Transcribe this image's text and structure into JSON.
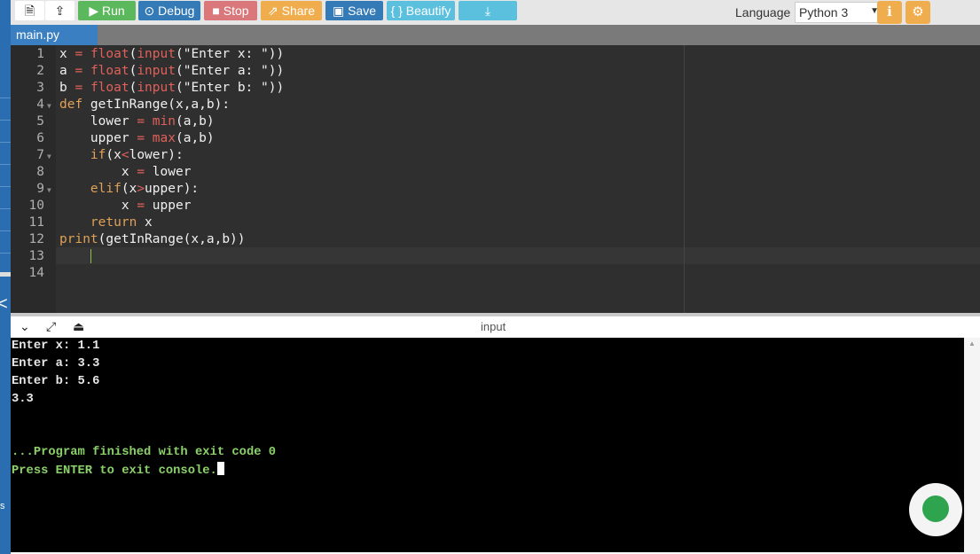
{
  "toolbar": {
    "run": "Run",
    "debug": "Debug",
    "stop": "Stop",
    "share": "Share",
    "save": "Save",
    "beautify": "{ } Beautify",
    "language_label": "Language",
    "language_value": "Python 3"
  },
  "tabs": [
    {
      "label": "main.py"
    }
  ],
  "code": [
    [
      [
        "x ",
        ""
      ],
      [
        "= ",
        "op"
      ],
      [
        "float",
        "fn"
      ],
      [
        "(",
        ""
      ],
      [
        "input",
        "fn"
      ],
      [
        "(\"Enter x: \"))",
        ""
      ]
    ],
    [
      [
        "a ",
        ""
      ],
      [
        "= ",
        "op"
      ],
      [
        "float",
        "fn"
      ],
      [
        "(",
        ""
      ],
      [
        "input",
        "fn"
      ],
      [
        "(\"Enter a: \"))",
        ""
      ]
    ],
    [
      [
        "b ",
        ""
      ],
      [
        "= ",
        "op"
      ],
      [
        "float",
        "fn"
      ],
      [
        "(",
        ""
      ],
      [
        "input",
        "fn"
      ],
      [
        "(\"Enter b: \"))",
        ""
      ]
    ],
    [
      [
        "def",
        "kw"
      ],
      [
        " getInRange(x,a,b):",
        ""
      ]
    ],
    [
      [
        "    lower ",
        ""
      ],
      [
        "= ",
        "op"
      ],
      [
        "min",
        "fn"
      ],
      [
        "(a,b)",
        ""
      ]
    ],
    [
      [
        "    upper ",
        ""
      ],
      [
        "= ",
        "op"
      ],
      [
        "max",
        "fn"
      ],
      [
        "(a,b)",
        ""
      ]
    ],
    [
      [
        "    ",
        ""
      ],
      [
        "if",
        "kw"
      ],
      [
        "(x",
        ""
      ],
      [
        "<",
        "op"
      ],
      [
        "lower):",
        ""
      ]
    ],
    [
      [
        "        x ",
        ""
      ],
      [
        "= ",
        "op"
      ],
      [
        "lower",
        ""
      ]
    ],
    [
      [
        "    ",
        ""
      ],
      [
        "elif",
        "kw"
      ],
      [
        "(x",
        ""
      ],
      [
        ">",
        "op"
      ],
      [
        "upper):",
        ""
      ]
    ],
    [
      [
        "        x ",
        ""
      ],
      [
        "= ",
        "op"
      ],
      [
        "upper",
        ""
      ]
    ],
    [
      [
        "    ",
        ""
      ],
      [
        "return",
        "kw"
      ],
      [
        " x",
        ""
      ]
    ],
    [
      [
        "print",
        "kw"
      ],
      [
        "(getInRange(x,a,b))",
        ""
      ]
    ],
    [],
    []
  ],
  "console": {
    "title": "input",
    "lines": [
      "Enter x: 1.1",
      "Enter a: 3.3",
      "Enter b: 5.6",
      "3.3",
      "",
      "",
      "...Program finished with exit code 0",
      "Press ENTER to exit console."
    ]
  }
}
